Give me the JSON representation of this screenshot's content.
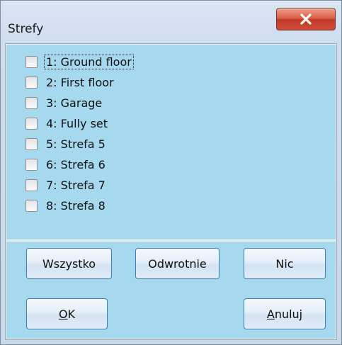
{
  "window": {
    "title": "Strefy"
  },
  "zones": [
    {
      "label": "1: Ground floor",
      "checked": false
    },
    {
      "label": "2: First floor",
      "checked": false
    },
    {
      "label": "3: Garage",
      "checked": false
    },
    {
      "label": "4: Fully set",
      "checked": false
    },
    {
      "label": "5: Strefa 5",
      "checked": false
    },
    {
      "label": "6: Strefa 6",
      "checked": false
    },
    {
      "label": "7: Strefa 7",
      "checked": false
    },
    {
      "label": "8: Strefa 8",
      "checked": false
    }
  ],
  "buttons": {
    "all": "Wszystko",
    "invert": "Odwrotnie",
    "none": "Nic",
    "ok_first": "O",
    "ok_rest": "K",
    "cancel_first": "A",
    "cancel_rest": "nuluj"
  },
  "icons": {
    "close": "close-icon"
  },
  "colors": {
    "list_bg": "#a6d8ee",
    "close_red": "#c0392b",
    "button_border": "#3c7fb1"
  }
}
